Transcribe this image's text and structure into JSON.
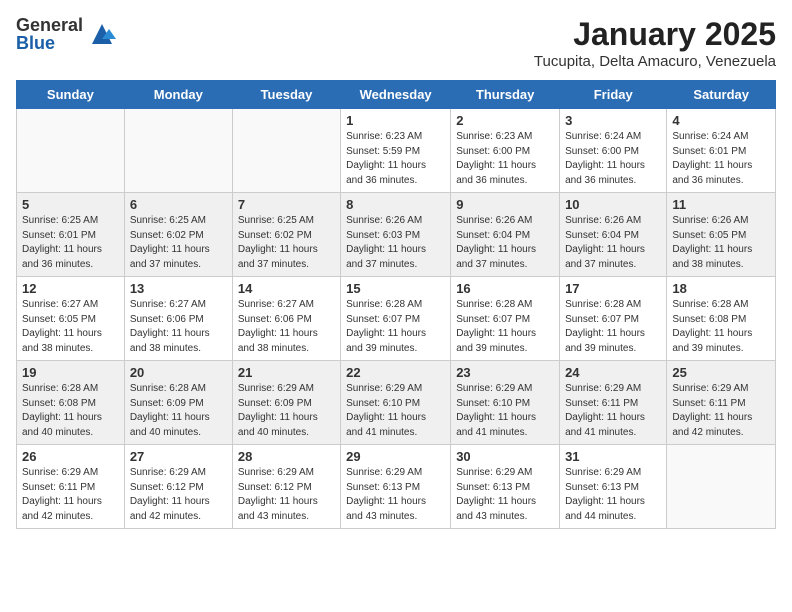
{
  "header": {
    "logo_general": "General",
    "logo_blue": "Blue",
    "month_title": "January 2025",
    "location": "Tucupita, Delta Amacuro, Venezuela"
  },
  "days_of_week": [
    "Sunday",
    "Monday",
    "Tuesday",
    "Wednesday",
    "Thursday",
    "Friday",
    "Saturday"
  ],
  "weeks": [
    {
      "shaded": false,
      "days": [
        {
          "num": "",
          "info": ""
        },
        {
          "num": "",
          "info": ""
        },
        {
          "num": "",
          "info": ""
        },
        {
          "num": "1",
          "info": "Sunrise: 6:23 AM\nSunset: 5:59 PM\nDaylight: 11 hours and 36 minutes."
        },
        {
          "num": "2",
          "info": "Sunrise: 6:23 AM\nSunset: 6:00 PM\nDaylight: 11 hours and 36 minutes."
        },
        {
          "num": "3",
          "info": "Sunrise: 6:24 AM\nSunset: 6:00 PM\nDaylight: 11 hours and 36 minutes."
        },
        {
          "num": "4",
          "info": "Sunrise: 6:24 AM\nSunset: 6:01 PM\nDaylight: 11 hours and 36 minutes."
        }
      ]
    },
    {
      "shaded": true,
      "days": [
        {
          "num": "5",
          "info": "Sunrise: 6:25 AM\nSunset: 6:01 PM\nDaylight: 11 hours and 36 minutes."
        },
        {
          "num": "6",
          "info": "Sunrise: 6:25 AM\nSunset: 6:02 PM\nDaylight: 11 hours and 37 minutes."
        },
        {
          "num": "7",
          "info": "Sunrise: 6:25 AM\nSunset: 6:02 PM\nDaylight: 11 hours and 37 minutes."
        },
        {
          "num": "8",
          "info": "Sunrise: 6:26 AM\nSunset: 6:03 PM\nDaylight: 11 hours and 37 minutes."
        },
        {
          "num": "9",
          "info": "Sunrise: 6:26 AM\nSunset: 6:04 PM\nDaylight: 11 hours and 37 minutes."
        },
        {
          "num": "10",
          "info": "Sunrise: 6:26 AM\nSunset: 6:04 PM\nDaylight: 11 hours and 37 minutes."
        },
        {
          "num": "11",
          "info": "Sunrise: 6:26 AM\nSunset: 6:05 PM\nDaylight: 11 hours and 38 minutes."
        }
      ]
    },
    {
      "shaded": false,
      "days": [
        {
          "num": "12",
          "info": "Sunrise: 6:27 AM\nSunset: 6:05 PM\nDaylight: 11 hours and 38 minutes."
        },
        {
          "num": "13",
          "info": "Sunrise: 6:27 AM\nSunset: 6:06 PM\nDaylight: 11 hours and 38 minutes."
        },
        {
          "num": "14",
          "info": "Sunrise: 6:27 AM\nSunset: 6:06 PM\nDaylight: 11 hours and 38 minutes."
        },
        {
          "num": "15",
          "info": "Sunrise: 6:28 AM\nSunset: 6:07 PM\nDaylight: 11 hours and 39 minutes."
        },
        {
          "num": "16",
          "info": "Sunrise: 6:28 AM\nSunset: 6:07 PM\nDaylight: 11 hours and 39 minutes."
        },
        {
          "num": "17",
          "info": "Sunrise: 6:28 AM\nSunset: 6:07 PM\nDaylight: 11 hours and 39 minutes."
        },
        {
          "num": "18",
          "info": "Sunrise: 6:28 AM\nSunset: 6:08 PM\nDaylight: 11 hours and 39 minutes."
        }
      ]
    },
    {
      "shaded": true,
      "days": [
        {
          "num": "19",
          "info": "Sunrise: 6:28 AM\nSunset: 6:08 PM\nDaylight: 11 hours and 40 minutes."
        },
        {
          "num": "20",
          "info": "Sunrise: 6:28 AM\nSunset: 6:09 PM\nDaylight: 11 hours and 40 minutes."
        },
        {
          "num": "21",
          "info": "Sunrise: 6:29 AM\nSunset: 6:09 PM\nDaylight: 11 hours and 40 minutes."
        },
        {
          "num": "22",
          "info": "Sunrise: 6:29 AM\nSunset: 6:10 PM\nDaylight: 11 hours and 41 minutes."
        },
        {
          "num": "23",
          "info": "Sunrise: 6:29 AM\nSunset: 6:10 PM\nDaylight: 11 hours and 41 minutes."
        },
        {
          "num": "24",
          "info": "Sunrise: 6:29 AM\nSunset: 6:11 PM\nDaylight: 11 hours and 41 minutes."
        },
        {
          "num": "25",
          "info": "Sunrise: 6:29 AM\nSunset: 6:11 PM\nDaylight: 11 hours and 42 minutes."
        }
      ]
    },
    {
      "shaded": false,
      "days": [
        {
          "num": "26",
          "info": "Sunrise: 6:29 AM\nSunset: 6:11 PM\nDaylight: 11 hours and 42 minutes."
        },
        {
          "num": "27",
          "info": "Sunrise: 6:29 AM\nSunset: 6:12 PM\nDaylight: 11 hours and 42 minutes."
        },
        {
          "num": "28",
          "info": "Sunrise: 6:29 AM\nSunset: 6:12 PM\nDaylight: 11 hours and 43 minutes."
        },
        {
          "num": "29",
          "info": "Sunrise: 6:29 AM\nSunset: 6:13 PM\nDaylight: 11 hours and 43 minutes."
        },
        {
          "num": "30",
          "info": "Sunrise: 6:29 AM\nSunset: 6:13 PM\nDaylight: 11 hours and 43 minutes."
        },
        {
          "num": "31",
          "info": "Sunrise: 6:29 AM\nSunset: 6:13 PM\nDaylight: 11 hours and 44 minutes."
        },
        {
          "num": "",
          "info": ""
        }
      ]
    }
  ]
}
